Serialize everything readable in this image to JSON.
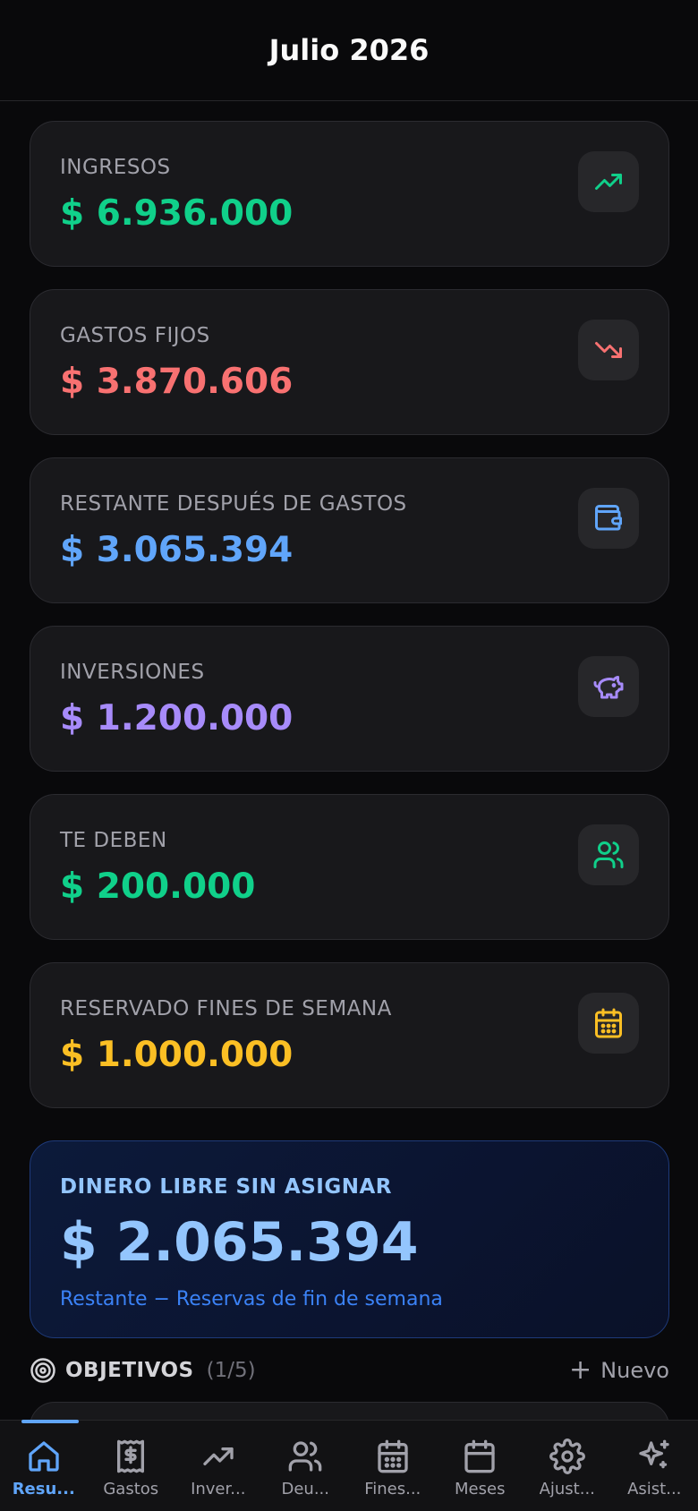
{
  "header": {
    "title": "Julio 2026"
  },
  "cards": [
    {
      "label": "INGRESOS",
      "value": "$ 6.936.000",
      "color": "#10d08a",
      "icon": "trending-up-icon"
    },
    {
      "label": "GASTOS FIJOS",
      "value": "$ 3.870.606",
      "color": "#f87171",
      "icon": "trending-down-icon"
    },
    {
      "label": "RESTANTE DESPUÉS DE GASTOS",
      "value": "$ 3.065.394",
      "color": "#60a5fa",
      "icon": "wallet-icon"
    },
    {
      "label": "INVERSIONES",
      "value": "$ 1.200.000",
      "color": "#a78bfa",
      "icon": "piggy-bank-icon"
    },
    {
      "label": "TE DEBEN",
      "value": "$ 200.000",
      "color": "#10d08a",
      "icon": "users-icon"
    },
    {
      "label": "RESERVADO FINES DE SEMANA",
      "value": "$ 1.000.000",
      "color": "#fbbf24",
      "icon": "calendar-icon"
    }
  ],
  "free_money": {
    "label": "DINERO LIBRE SIN ASIGNAR",
    "value": "$ 2.065.394",
    "subtitle": "Restante − Reservas de fin de semana"
  },
  "objectives": {
    "title": "OBJETIVOS",
    "count": "(1/5)",
    "new_label": "Nuevo"
  },
  "nav": {
    "items": [
      {
        "label": "Resu...",
        "icon": "home-icon",
        "active": true
      },
      {
        "label": "Gastos",
        "icon": "receipt-icon",
        "active": false
      },
      {
        "label": "Inver...",
        "icon": "trending-up-icon",
        "active": false
      },
      {
        "label": "Deu...",
        "icon": "users-icon",
        "active": false
      },
      {
        "label": "Fines...",
        "icon": "calendar-grid-icon",
        "active": false
      },
      {
        "label": "Meses",
        "icon": "calendar-icon",
        "active": false
      },
      {
        "label": "Ajust...",
        "icon": "gear-icon",
        "active": false
      },
      {
        "label": "Asist...",
        "icon": "sparkles-icon",
        "active": false
      }
    ]
  }
}
